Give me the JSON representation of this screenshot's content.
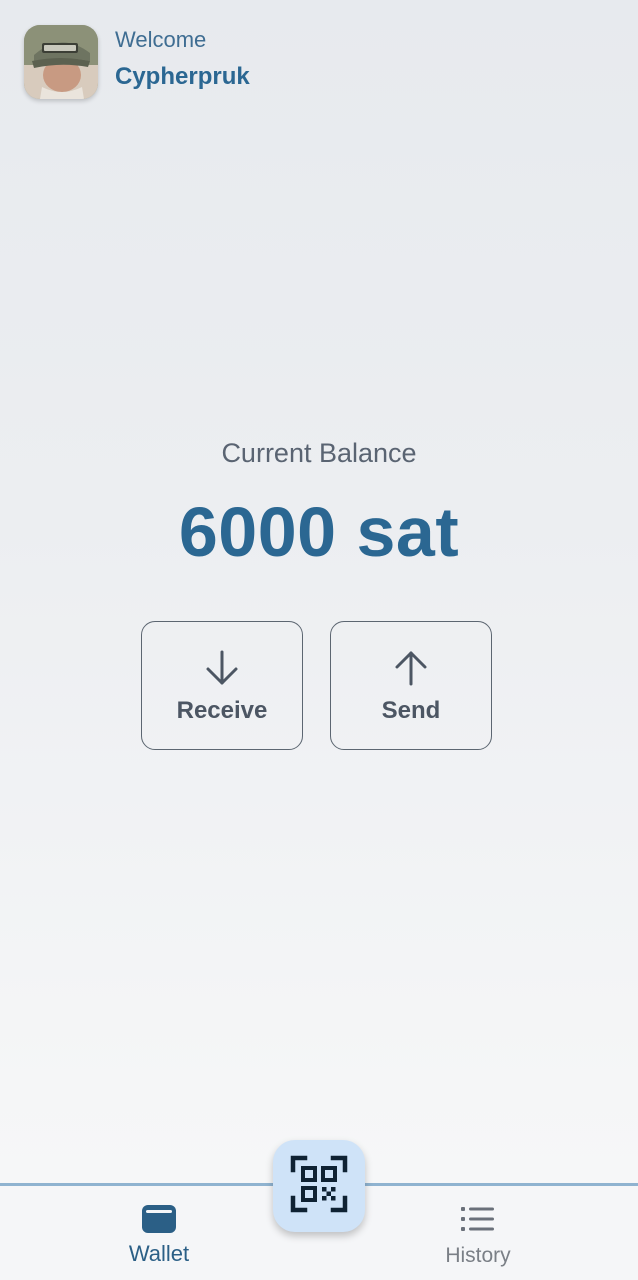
{
  "header": {
    "welcome_label": "Welcome",
    "user_name": "Cypherpruk",
    "avatar_icon": "user-avatar-photo"
  },
  "balance": {
    "label": "Current Balance",
    "value": "6000 sat"
  },
  "actions": {
    "receive_label": "Receive",
    "receive_icon": "arrow-down-icon",
    "send_label": "Send",
    "send_icon": "arrow-up-icon"
  },
  "nav": {
    "wallet_label": "Wallet",
    "wallet_icon": "wallet-icon",
    "history_label": "History",
    "history_icon": "list-icon",
    "scan_icon": "qr-scan-icon",
    "active_tab": "Wallet"
  },
  "colors": {
    "accent": "#2b6792",
    "fab_background": "#cfe3f8",
    "muted_text": "#5a6472",
    "nav_border": "#8fb3d0"
  }
}
